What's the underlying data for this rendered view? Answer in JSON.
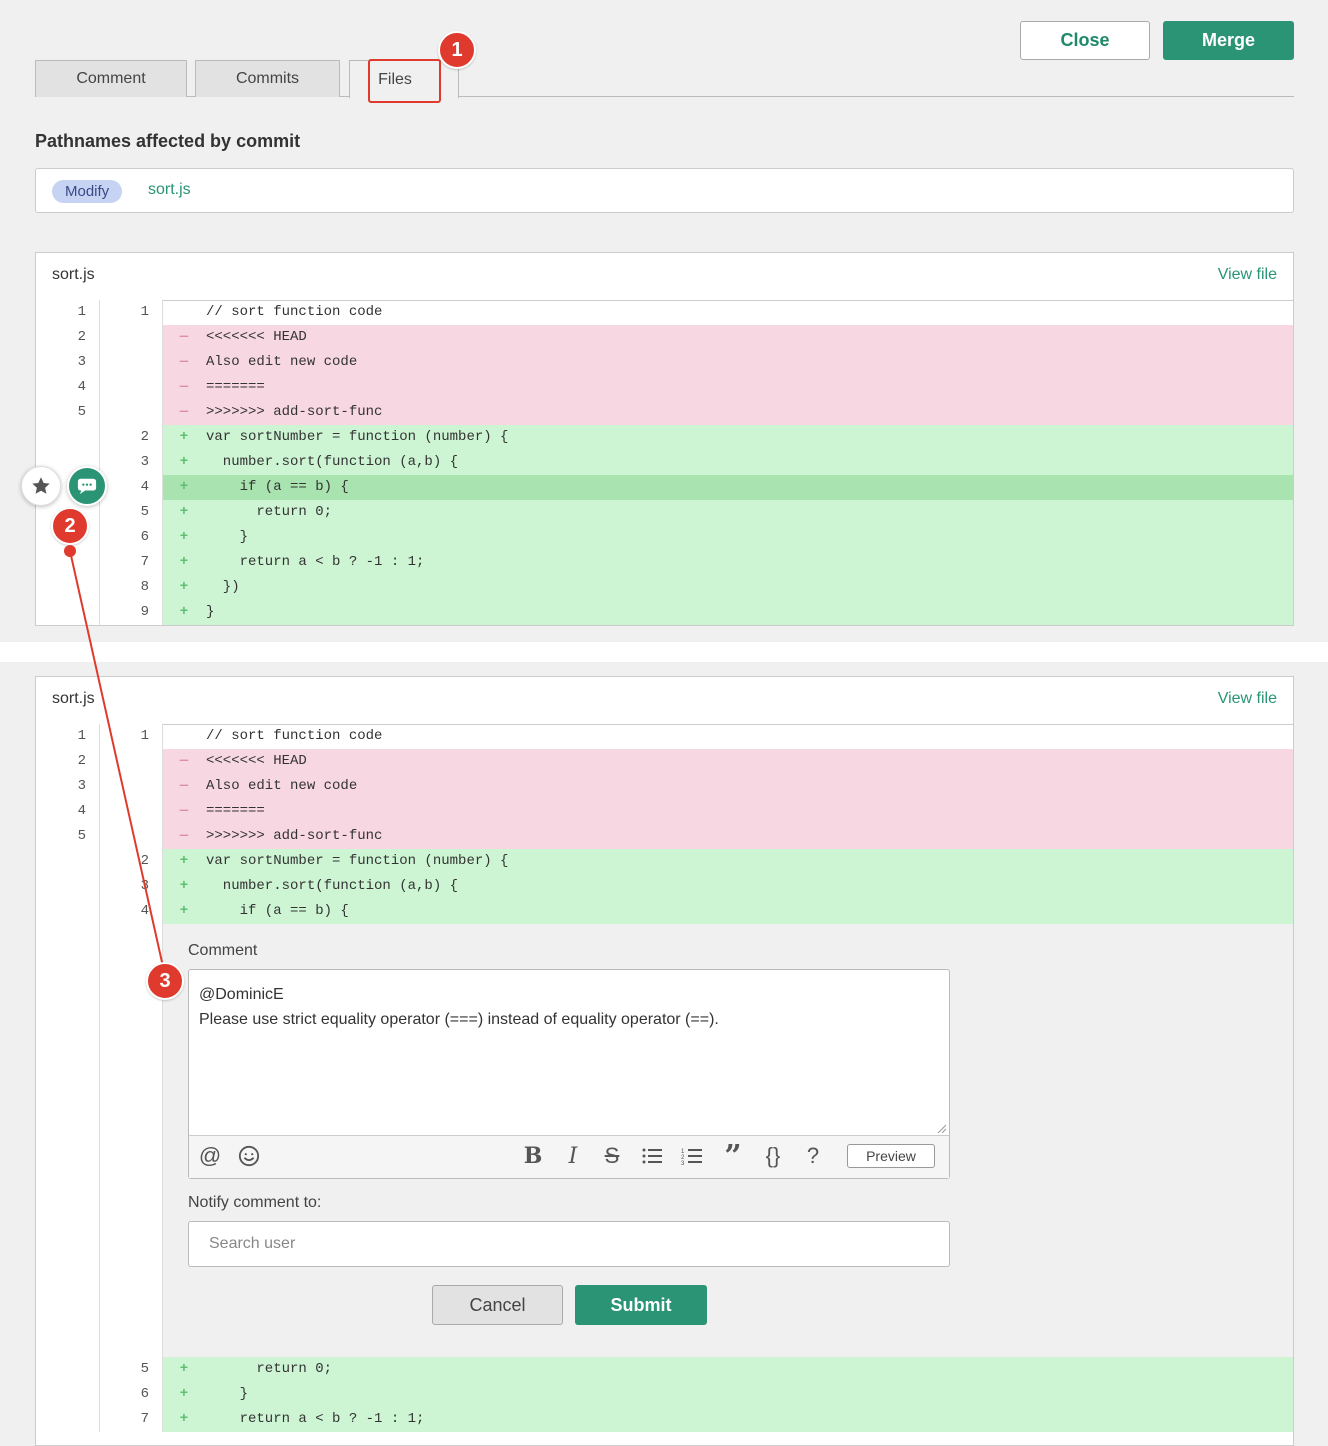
{
  "header": {
    "close_label": "Close",
    "merge_label": "Merge"
  },
  "tabs": [
    {
      "label": "Comment"
    },
    {
      "label": "Commits"
    },
    {
      "label": "Files"
    }
  ],
  "callouts": [
    "1",
    "2",
    "3"
  ],
  "pathnames": {
    "title": "Pathnames affected by commit",
    "tag": "Modify",
    "file": "sort.js"
  },
  "panel": {
    "name": "sort.js",
    "view_file": "View file"
  },
  "diff_lines": [
    {
      "old": "1",
      "new": "1",
      "type": "ctx",
      "text": "// sort function code"
    },
    {
      "old": "2",
      "new": "",
      "type": "del",
      "text": "<<<<<<< HEAD"
    },
    {
      "old": "3",
      "new": "",
      "type": "del",
      "text": "Also edit new code"
    },
    {
      "old": "4",
      "new": "",
      "type": "del",
      "text": "======="
    },
    {
      "old": "5",
      "new": "",
      "type": "del",
      "text": ">>>>>>> add-sort-func"
    },
    {
      "old": "",
      "new": "2",
      "type": "add",
      "text": "var sortNumber = function (number) {"
    },
    {
      "old": "",
      "new": "3",
      "type": "add",
      "text": "  number.sort(function (a,b) {"
    },
    {
      "old": "",
      "new": "4",
      "type": "add",
      "text": "    if (a == b) {"
    },
    {
      "old": "",
      "new": "5",
      "type": "add",
      "text": "      return 0;"
    },
    {
      "old": "",
      "new": "6",
      "type": "add",
      "text": "    }"
    },
    {
      "old": "",
      "new": "7",
      "type": "add",
      "text": "    return a < b ? -1 : 1;"
    },
    {
      "old": "",
      "new": "8",
      "type": "add",
      "text": "  })"
    },
    {
      "old": "",
      "new": "9",
      "type": "add",
      "text": "}"
    }
  ],
  "comment_form": {
    "label": "Comment",
    "mention": "@DominicE",
    "body": "Please use strict equality operator (===) instead of equality operator (==).",
    "preview_label": "Preview",
    "notify_label": "Notify comment to:",
    "search_placeholder": "Search user",
    "cancel_label": "Cancel",
    "submit_label": "Submit"
  },
  "icons": {
    "star": "star-icon",
    "comment": "comment-bubble-icon",
    "at": "at-sign-icon",
    "emoji": "emoji-icon",
    "bold": "B",
    "italic": "I",
    "strike": "S",
    "bullet": "bullet-list-icon",
    "numbered": "numbered-list-icon",
    "quote": "quote-icon",
    "code": "{}",
    "help": "?"
  },
  "colors": {
    "accent": "#2a9474",
    "callout": "#e03a2e",
    "deleted_bg": "#f7d7e2",
    "added_bg": "#cdf5d4"
  }
}
